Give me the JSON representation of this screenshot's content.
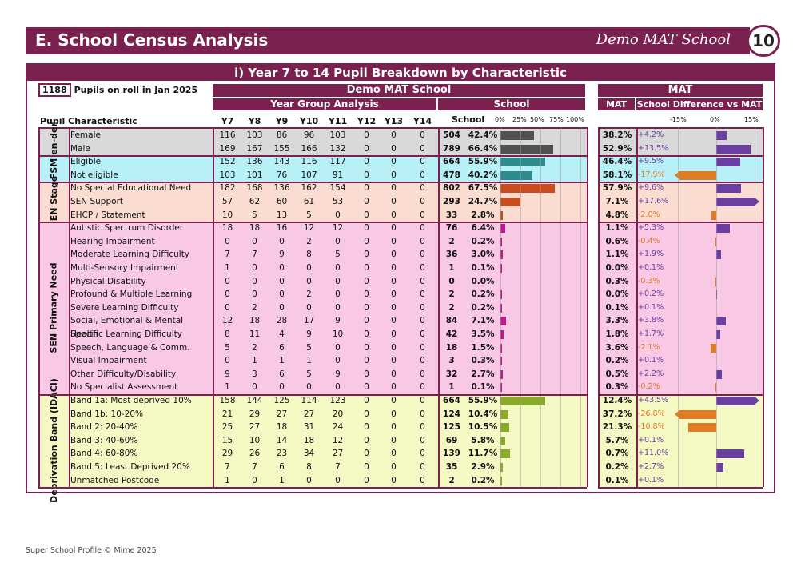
{
  "header": {
    "title": "E.  School Census Analysis",
    "school": "Demo MAT School",
    "page": "10"
  },
  "panel_title": "i) Year 7 to 14 Pupil Breakdown by Characteristic",
  "pupils": {
    "count": "1188",
    "label": "Pupils on roll in Jan 2025"
  },
  "bands": {
    "school_name": "Demo MAT School",
    "mat": "MAT",
    "year_group": "Year Group Analysis",
    "school": "School",
    "mat_col": "MAT",
    "diff": "School Difference vs MAT"
  },
  "columns": {
    "characteristic": "Pupil Characteristic",
    "years": [
      "Y7",
      "Y8",
      "Y9",
      "Y10",
      "Y11",
      "Y12",
      "Y13",
      "Y14"
    ],
    "school": "School"
  },
  "axis_school": [
    "0%",
    "25%",
    "50%",
    "75%",
    "100%"
  ],
  "axis_diff": [
    "-15%",
    "0%",
    "15%"
  ],
  "groups": [
    {
      "label": "Gen-der",
      "rows": [
        0,
        1
      ],
      "color": "#d9d9d9"
    },
    {
      "label": "FSM",
      "rows": [
        2,
        3
      ],
      "color": "#b8f0f7"
    },
    {
      "label": "SEN Stage",
      "rows": [
        4,
        6
      ],
      "color": "#fadcd0"
    },
    {
      "label": "SEN Primary Need",
      "rows": [
        7,
        19
      ],
      "color": "#f8c8e4"
    },
    {
      "label": "Deprivation Band (IDACI)",
      "rows": [
        20,
        26
      ],
      "color": "#f4f9c4"
    }
  ],
  "colors": {
    "accent": "#7a2150",
    "gender": "#505050",
    "fsm": "#2e8b8b",
    "sen": "#c84c1e",
    "need": "#c0188c",
    "depr": "#8aa82a",
    "pos": "#6b3fa0",
    "neg": "#e07b22"
  },
  "rows": [
    {
      "name": "Female",
      "years": [
        "116",
        "103",
        "86",
        "96",
        "103",
        "0",
        "0",
        "0"
      ],
      "total": "504",
      "pct": "42.4%",
      "v": 42.4,
      "mat": "38.2%",
      "diff": "+4.2%",
      "d": 4.2
    },
    {
      "name": "Male",
      "years": [
        "169",
        "167",
        "155",
        "166",
        "132",
        "0",
        "0",
        "0"
      ],
      "total": "789",
      "pct": "66.4%",
      "v": 66.4,
      "mat": "52.9%",
      "diff": "+13.5%",
      "d": 13.5
    },
    {
      "name": "Eligible",
      "years": [
        "152",
        "136",
        "143",
        "116",
        "117",
        "0",
        "0",
        "0"
      ],
      "total": "664",
      "pct": "55.9%",
      "v": 55.9,
      "mat": "46.4%",
      "diff": "+9.5%",
      "d": 9.5
    },
    {
      "name": "Not eligible",
      "years": [
        "103",
        "101",
        "76",
        "107",
        "91",
        "0",
        "0",
        "0"
      ],
      "total": "478",
      "pct": "40.2%",
      "v": 40.2,
      "mat": "58.1%",
      "diff": "-17.9%",
      "d": -17.9
    },
    {
      "name": "No Special Educational Need",
      "years": [
        "182",
        "168",
        "136",
        "162",
        "154",
        "0",
        "0",
        "0"
      ],
      "total": "802",
      "pct": "67.5%",
      "v": 67.5,
      "mat": "57.9%",
      "diff": "+9.6%",
      "d": 9.6
    },
    {
      "name": "SEN Support",
      "years": [
        "57",
        "62",
        "60",
        "61",
        "53",
        "0",
        "0",
        "0"
      ],
      "total": "293",
      "pct": "24.7%",
      "v": 24.7,
      "mat": "7.1%",
      "diff": "+17.6%",
      "d": 17.6
    },
    {
      "name": "EHCP / Statement",
      "years": [
        "10",
        "5",
        "13",
        "5",
        "0",
        "0",
        "0",
        "0"
      ],
      "total": "33",
      "pct": "2.8%",
      "v": 2.8,
      "mat": "4.8%",
      "diff": "-2.0%",
      "d": -2.0
    },
    {
      "name": "Autistic Spectrum Disorder",
      "years": [
        "18",
        "18",
        "16",
        "12",
        "12",
        "0",
        "0",
        "0"
      ],
      "total": "76",
      "pct": "6.4%",
      "v": 6.4,
      "mat": "1.1%",
      "diff": "+5.3%",
      "d": 5.3
    },
    {
      "name": "Hearing Impairment",
      "years": [
        "0",
        "0",
        "0",
        "2",
        "0",
        "0",
        "0",
        "0"
      ],
      "total": "2",
      "pct": "0.2%",
      "v": 0.2,
      "mat": "0.6%",
      "diff": "-0.4%",
      "d": -0.4
    },
    {
      "name": "Moderate Learning Difficulty",
      "years": [
        "7",
        "7",
        "9",
        "8",
        "5",
        "0",
        "0",
        "0"
      ],
      "total": "36",
      "pct": "3.0%",
      "v": 3.0,
      "mat": "1.1%",
      "diff": "+1.9%",
      "d": 1.9
    },
    {
      "name": "Multi-Sensory Impairment",
      "years": [
        "1",
        "0",
        "0",
        "0",
        "0",
        "0",
        "0",
        "0"
      ],
      "total": "1",
      "pct": "0.1%",
      "v": 0.1,
      "mat": "0.0%",
      "diff": "+0.1%",
      "d": 0.1
    },
    {
      "name": "Physical Disability",
      "years": [
        "0",
        "0",
        "0",
        "0",
        "0",
        "0",
        "0",
        "0"
      ],
      "total": "0",
      "pct": "0.0%",
      "v": 0.0,
      "mat": "0.3%",
      "diff": "-0.3%",
      "d": -0.3
    },
    {
      "name": "Profound & Multiple Learning",
      "years": [
        "0",
        "0",
        "0",
        "2",
        "0",
        "0",
        "0",
        "0"
      ],
      "total": "2",
      "pct": "0.2%",
      "v": 0.2,
      "mat": "0.0%",
      "diff": "+0.2%",
      "d": 0.2
    },
    {
      "name": "Severe Learning Difficulty",
      "years": [
        "0",
        "2",
        "0",
        "0",
        "0",
        "0",
        "0",
        "0"
      ],
      "total": "2",
      "pct": "0.2%",
      "v": 0.2,
      "mat": "0.1%",
      "diff": "+0.1%",
      "d": 0.1
    },
    {
      "name": "Social, Emotional & Mental Health",
      "years": [
        "12",
        "18",
        "28",
        "17",
        "9",
        "0",
        "0",
        "0"
      ],
      "total": "84",
      "pct": "7.1%",
      "v": 7.1,
      "mat": "3.3%",
      "diff": "+3.8%",
      "d": 3.8
    },
    {
      "name": "Specific Learning Difficulty",
      "years": [
        "8",
        "11",
        "4",
        "9",
        "10",
        "0",
        "0",
        "0"
      ],
      "total": "42",
      "pct": "3.5%",
      "v": 3.5,
      "mat": "1.8%",
      "diff": "+1.7%",
      "d": 1.7
    },
    {
      "name": "Speech, Language & Comm.",
      "years": [
        "5",
        "2",
        "6",
        "5",
        "0",
        "0",
        "0",
        "0"
      ],
      "total": "18",
      "pct": "1.5%",
      "v": 1.5,
      "mat": "3.6%",
      "diff": "-2.1%",
      "d": -2.1
    },
    {
      "name": "Visual Impairment",
      "years": [
        "0",
        "1",
        "1",
        "1",
        "0",
        "0",
        "0",
        "0"
      ],
      "total": "3",
      "pct": "0.3%",
      "v": 0.3,
      "mat": "0.2%",
      "diff": "+0.1%",
      "d": 0.1
    },
    {
      "name": "Other Difficulty/Disability",
      "years": [
        "9",
        "3",
        "6",
        "5",
        "9",
        "0",
        "0",
        "0"
      ],
      "total": "32",
      "pct": "2.7%",
      "v": 2.7,
      "mat": "0.5%",
      "diff": "+2.2%",
      "d": 2.2
    },
    {
      "name": "No Specialist Assessment",
      "years": [
        "1",
        "0",
        "0",
        "0",
        "0",
        "0",
        "0",
        "0"
      ],
      "total": "1",
      "pct": "0.1%",
      "v": 0.1,
      "mat": "0.3%",
      "diff": "-0.2%",
      "d": -0.2
    },
    {
      "name": "Band 1a: Most deprived 10%",
      "years": [
        "158",
        "144",
        "125",
        "114",
        "123",
        "0",
        "0",
        "0"
      ],
      "total": "664",
      "pct": "55.9%",
      "v": 55.9,
      "mat": "12.4%",
      "diff": "+43.5%",
      "d": 43.5
    },
    {
      "name": "Band 1b: 10-20%",
      "years": [
        "21",
        "29",
        "27",
        "27",
        "20",
        "0",
        "0",
        "0"
      ],
      "total": "124",
      "pct": "10.4%",
      "v": 10.4,
      "mat": "37.2%",
      "diff": "-26.8%",
      "d": -26.8
    },
    {
      "name": "Band 2: 20-40%",
      "years": [
        "25",
        "27",
        "18",
        "31",
        "24",
        "0",
        "0",
        "0"
      ],
      "total": "125",
      "pct": "10.5%",
      "v": 10.5,
      "mat": "21.3%",
      "diff": "-10.8%",
      "d": -10.8
    },
    {
      "name": "Band 3: 40-60%",
      "years": [
        "15",
        "10",
        "14",
        "18",
        "12",
        "0",
        "0",
        "0"
      ],
      "total": "69",
      "pct": "5.8%",
      "v": 5.8,
      "mat": "5.7%",
      "diff": "+0.1%",
      "d": 0.1
    },
    {
      "name": "Band 4: 60-80%",
      "years": [
        "29",
        "26",
        "23",
        "34",
        "27",
        "0",
        "0",
        "0"
      ],
      "total": "139",
      "pct": "11.7%",
      "v": 11.7,
      "mat": "0.7%",
      "diff": "+11.0%",
      "d": 11.0
    },
    {
      "name": "Band 5: Least Deprived 20%",
      "years": [
        "7",
        "7",
        "6",
        "8",
        "7",
        "0",
        "0",
        "0"
      ],
      "total": "35",
      "pct": "2.9%",
      "v": 2.9,
      "mat": "0.2%",
      "diff": "+2.7%",
      "d": 2.7
    },
    {
      "name": "Unmatched Postcode",
      "years": [
        "1",
        "0",
        "1",
        "0",
        "0",
        "0",
        "0",
        "0"
      ],
      "total": "2",
      "pct": "0.2%",
      "v": 0.2,
      "mat": "0.1%",
      "diff": "+0.1%",
      "d": 0.1
    }
  ],
  "footer": "Super School Profile © Mime 2025"
}
